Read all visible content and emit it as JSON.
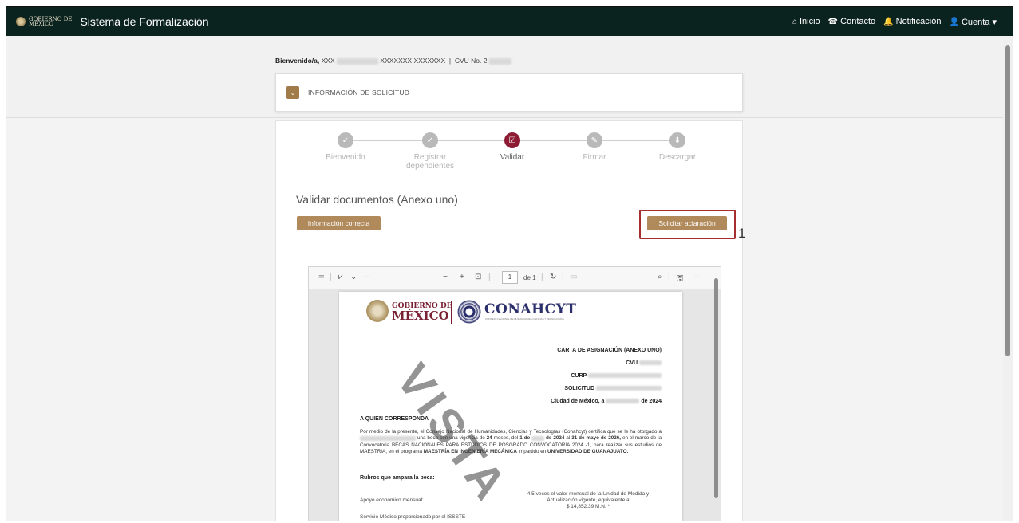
{
  "navbar": {
    "logo_text": "GOBIERNO DE\nMÉXICO",
    "title": "Sistema de Formalización",
    "links": [
      {
        "icon": "home-icon",
        "glyph": "⌂",
        "label": "Inicio"
      },
      {
        "icon": "contact-icon",
        "glyph": "☎",
        "label": "Contacto"
      },
      {
        "icon": "bell-icon",
        "glyph": "🔔",
        "label": "Notificación"
      },
      {
        "icon": "user-icon",
        "glyph": "👤",
        "label": "Cuenta ▾"
      }
    ]
  },
  "header": {
    "welcome_label": "Bienvenido/a,",
    "welcome_name": "XXX",
    "welcome_name_tail": "XXXXXXX XXXXXXX",
    "separator": "|",
    "cvu_label": "CVU No. 2"
  },
  "solicitud": {
    "chevron": "⌄",
    "label": "INFORMACIÓN DE SOLICITUD"
  },
  "stepper": {
    "steps": [
      {
        "label": "Bienvenido",
        "glyph": "✓",
        "active": false
      },
      {
        "label": "Registrar dependientes",
        "glyph": "✓",
        "active": false
      },
      {
        "label": "Validar",
        "glyph": "☑",
        "active": true
      },
      {
        "label": "Firmar",
        "glyph": "✎",
        "active": false
      },
      {
        "label": "Descargar",
        "glyph": "⬇",
        "active": false
      }
    ]
  },
  "section": {
    "title": "Validar documentos (Anexo uno)",
    "btn_correct": "Información correcta",
    "btn_clarify": "Solicitar aclaración",
    "callout": "1"
  },
  "viewer": {
    "page_input": "1",
    "page_total": "de 1",
    "tools": {
      "contents": "≔",
      "draw": "⩗",
      "chevron": "⌄",
      "more_left": "···",
      "zoom_out": "−",
      "zoom_in": "+",
      "fit": "⊡",
      "rotate": "↻",
      "page_view": "▭",
      "search": "⌕",
      "save": "🖫",
      "more_right": "···"
    }
  },
  "document": {
    "gob_line1": "GOBIERNO DE",
    "gob_line2": "MÉXICO",
    "conah_title": "CONAHCYT",
    "conah_sub": "CONSEJO NACIONAL DE HUMANIDADES CIENCIAS Y TECNOLOGÍAS",
    "doc_title": "CARTA DE ASIGNACIÓN (ANEXO UNO)",
    "cvu_label": "CVU",
    "curp_label": "CURP",
    "solicitud_label": "SOLICITUD",
    "date_prefix": "Ciudad de México, a",
    "date_suffix": "de 2024",
    "salutation": "A QUIEN CORRESPONDA",
    "para_1": "Por medio de la presente, el Consejo Nacional de Humanidades, Ciencias y Tecnologías (Conahcyt) certifica que se le ha otorgado a",
    "para_2": "una beca con una vigencia de",
    "months": "24",
    "para_3": "meses, del",
    "start_day": "1 de",
    "start_year": "de 2024",
    "para_4": "al",
    "end_date": "31 de mayo de 2026,",
    "para_5": "en el marco de la Convocatoria BECAS NACIONALES PARA ESTUDIOS DE POSGRADO CONVOCATORIA 2024 -1, para realizar sus estudios de MAESTRIA, en el programa",
    "program": "MAESTRÍA EN INGENIERÍA MECÁNICA",
    "para_6": "impartido en",
    "university": "UNIVERSIDAD DE GUANAJUATO.",
    "rubros_title": "Rubros que ampara la beca:",
    "rubro_1_label": "Apoyo económico mensual:",
    "rubro_1_value_a": "4.5 veces el valor mensual de la Unidad de Medida y",
    "rubro_1_value_b": "Actualización vigente, equivalente a",
    "rubro_1_value_c": "$ 14,852.39 M.N. *",
    "rubro_2_label": "Servicio Médico proporcionado por el ISSSTE",
    "watermark": "VISTA"
  },
  "colors": {
    "navbar": "#0b231e",
    "gold": "#b08a5b",
    "active_step": "#8c1b33",
    "highlight": "#a52f2f",
    "gob_red": "#7a2133",
    "conah_blue": "#2b2f6b"
  }
}
